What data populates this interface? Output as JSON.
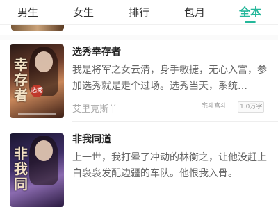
{
  "tabs": [
    {
      "label": "男生"
    },
    {
      "label": "女生"
    },
    {
      "label": "排行"
    },
    {
      "label": "包月"
    },
    {
      "label": "全本"
    }
  ],
  "active_tab": "全本",
  "colors": {
    "accent": "#24b79a",
    "text": "#222222",
    "muted": "#666666"
  },
  "books": [
    {
      "title": "选秀幸存者",
      "description": "我是将军之女云清，身手敏捷，无心入宫，参加选秀就是走个过场。选秀当天，系统…",
      "author": "艾里克斯羊",
      "category": "宅斗宫斗",
      "word_count": "1.0万字",
      "cover_text": "幸存者",
      "cover_badge": "选秀"
    },
    {
      "title": "非我同道",
      "description": "上一世，我打晕了冲动的林衡之，让他没赶上白袅袅发配边疆的车队。他恨我入骨。",
      "cover_text": "非我同"
    }
  ]
}
